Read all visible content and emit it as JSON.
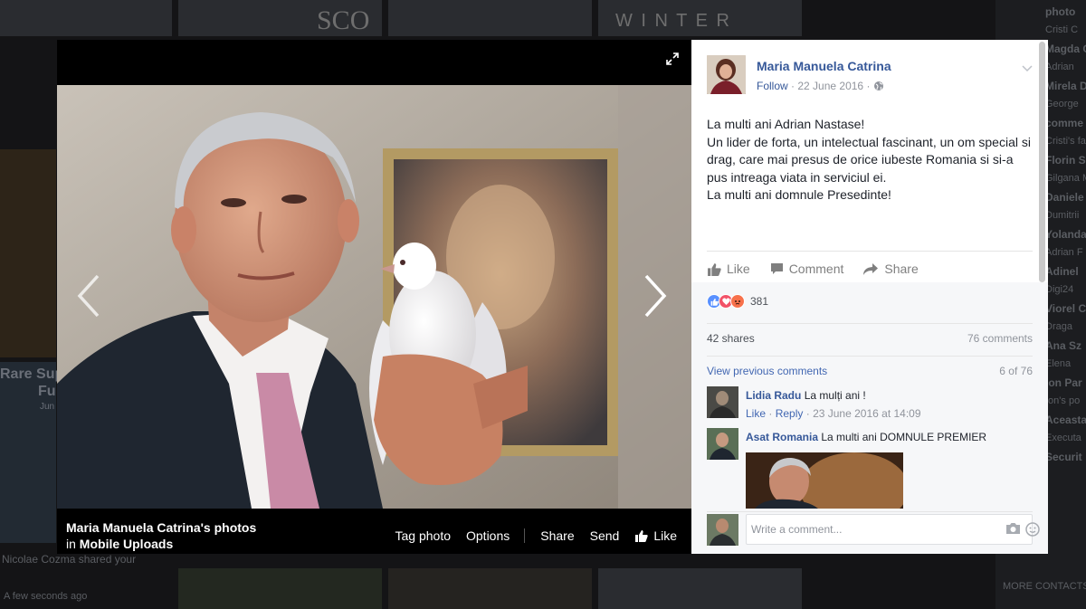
{
  "background": {
    "right_column": [
      "photo",
      "Cristi C",
      "Magda G",
      "Adrian",
      "Mirela D",
      "George",
      "comme",
      "Cristi's fa",
      "Florin S",
      "Gilgana M",
      "Daniele",
      "Dumitrii",
      "Yolanda",
      "Adrian F",
      "Adinel",
      "Digi24",
      "Viorel C",
      "Draga",
      "Ana Sz",
      "Elena",
      "Ion Par",
      "Ion's po",
      "Aceasta",
      "Executa",
      "Securit"
    ],
    "left_fragments": [
      "Rare Sup",
      "Fu",
      "Jun",
      "Nicolae Cozma shared your",
      "A few seconds ago"
    ],
    "top_tiles": [
      "SCO",
      "W I N T E R"
    ],
    "more_contacts": "MORE CONTACTS"
  },
  "theater": {
    "album_owner": "Maria Manuela Catrina's photos",
    "album_prefix": "in",
    "album_name": "Mobile Uploads",
    "actions": {
      "tag_photo": "Tag photo",
      "options": "Options",
      "share": "Share",
      "send": "Send",
      "like": "Like"
    }
  },
  "post": {
    "author": "Maria Manuela Catrina",
    "follow": "Follow",
    "date": "22 June 2016",
    "text": [
      "La multi ani Adrian Nastase!",
      "Un lider de forta, un intelectual fascinant, un om special si drag, care mai presus de orice iubeste Romania si si-a pus intreaga viata in serviciul ei.",
      "La multi ani domnule Presedinte!"
    ],
    "actions": {
      "like": "Like",
      "comment": "Comment",
      "share": "Share"
    },
    "reaction_count": "381",
    "shares": "42 shares",
    "comments_count": "76 comments",
    "view_previous": "View previous comments",
    "comments_range": "6 of 76",
    "colors": {
      "link": "#365899",
      "like_blue": "#4267b2",
      "love": "#f25268",
      "angry": "#f7714b"
    }
  },
  "comments": [
    {
      "name": "Lidia Radu",
      "text": "La mulți ani !",
      "like": "Like",
      "reply": "Reply",
      "timestamp": "23 June 2016 at 14:09"
    },
    {
      "name": "Asat Romania",
      "text": "La multi ani DOMNULE PREMIER"
    }
  ],
  "composer": {
    "placeholder": "Write a comment..."
  }
}
